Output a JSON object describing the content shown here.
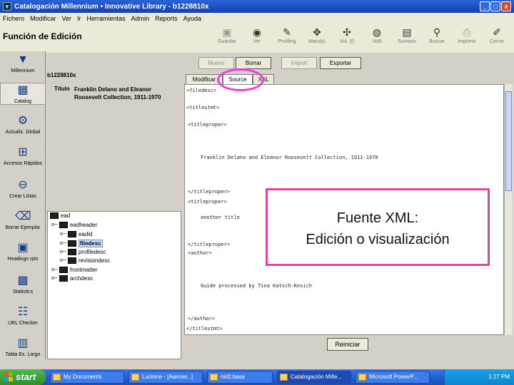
{
  "window": {
    "title": "Catalogación Millennium • Innovative Library - b1228810x",
    "buttons": [
      "_",
      "□",
      "x"
    ]
  },
  "menu": [
    "Fichero",
    "Modificar",
    "Ver",
    "Ir",
    "Herramientas",
    "Admin",
    "Reports",
    "Ayuda"
  ],
  "screen_title": "Función de Edición",
  "toolbar": [
    {
      "label": "Guardar",
      "icon": "save-icon"
    },
    {
      "label": "Ver",
      "icon": "eye-icon"
    },
    {
      "label": "Profiling",
      "icon": "edit-icon"
    },
    {
      "label": "Marc(ti)",
      "icon": "marc-icon"
    },
    {
      "label": "Vol. (f)",
      "icon": "volume-icon"
    },
    {
      "label": "VoB",
      "icon": "globe-icon"
    },
    {
      "label": "Sumario",
      "icon": "summary-icon"
    },
    {
      "label": "Buscar",
      "icon": "search-icon"
    },
    {
      "label": "Imprimir",
      "icon": "print-icon"
    },
    {
      "label": "Cerrar",
      "icon": "close-icon"
    }
  ],
  "sidebar": [
    {
      "label": "Millennium",
      "icon": "millennium-logo-icon"
    },
    {
      "label": "Catalog",
      "icon": "catalog-icon"
    },
    {
      "label": "Actualiz. Global",
      "icon": "global-update-icon"
    },
    {
      "label": "Accesos Rápidos",
      "icon": "quick-access-icon"
    },
    {
      "label": "Crear Listas",
      "icon": "lists-icon"
    },
    {
      "label": "Borrar Ejemplar",
      "icon": "delete-item-icon"
    },
    {
      "label": "Headings rpts",
      "icon": "headings-icon"
    },
    {
      "label": "Statistics",
      "icon": "statistics-icon"
    },
    {
      "label": "URL Checker",
      "icon": "url-checker-icon"
    },
    {
      "label": "Tabla Ex. Largo",
      "icon": "table-icon"
    }
  ],
  "actions": {
    "new": "Nuevo",
    "delete": "Borrar",
    "import": "Import",
    "export": "Exportar"
  },
  "record_id": "b1228810x",
  "info": {
    "label": "Título",
    "value": "Franklin Delano and Eleanor Roosevelt Collection, 1911-1970"
  },
  "tree": [
    {
      "label": "ead",
      "level": 0
    },
    {
      "label": "eadheader",
      "level": 1
    },
    {
      "label": "eadid",
      "level": 2
    },
    {
      "label": "filedesc",
      "level": 2,
      "selected": true
    },
    {
      "label": "profiledesc",
      "level": 2
    },
    {
      "label": "revisiondesc",
      "level": 2
    },
    {
      "label": "frontmatter",
      "level": 1
    },
    {
      "label": "archdesc",
      "level": 1
    }
  ],
  "tabs": [
    "Modificar",
    "Source",
    "XSL"
  ],
  "xml_lines": [
    "<filedesc>",
    "<titlestmt>",
    "<titleproper>",
    "Franklin Delano and Eleanor Roosevelt Collection, 1911-1970",
    "</titleproper>",
    "<titleproper>",
    "another title",
    "</titleproper>",
    "<author>",
    "Guide processed by Tina Katsch-Kesich",
    "</author>",
    "</titlestmt>"
  ],
  "reset_label": "Reiniciar",
  "callout": {
    "line1": "Fuente XML:",
    "line2": "Edición o visualización"
  },
  "taskbar": {
    "start": "start",
    "tasks": [
      "My Documents",
      "Lucinne - [Aarrow...]",
      "mil2.base",
      "Catalogación Mille...",
      "Microsoft PowerP..."
    ],
    "clock": "1:27 PM"
  }
}
